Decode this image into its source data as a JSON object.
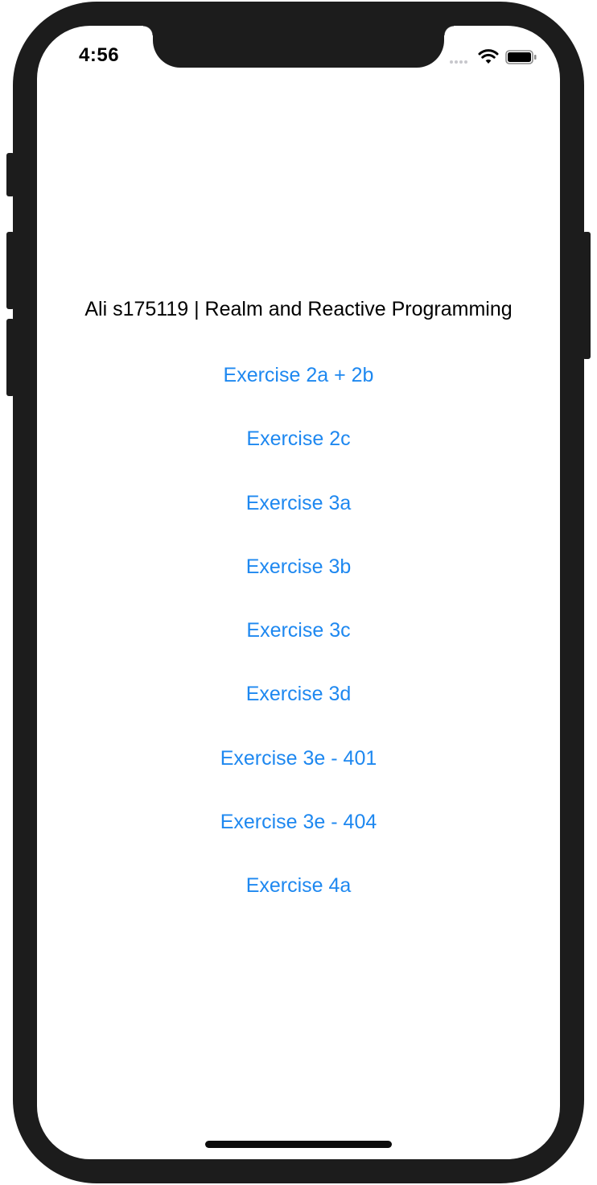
{
  "status_bar": {
    "time": "4:56",
    "signal_icon": "cellular-signal-icon",
    "wifi_icon": "wifi-icon",
    "battery_icon": "battery-icon"
  },
  "main": {
    "title": "Ali s175119 | Realm and Reactive Programming",
    "menu_items": [
      {
        "label": "Exercise 2a + 2b"
      },
      {
        "label": "Exercise 2c"
      },
      {
        "label": "Exercise 3a"
      },
      {
        "label": "Exercise 3b"
      },
      {
        "label": "Exercise 3c"
      },
      {
        "label": "Exercise 3d"
      },
      {
        "label": "Exercise 3e - 401"
      },
      {
        "label": "Exercise 3e - 404"
      },
      {
        "label": "Exercise 4a"
      }
    ]
  },
  "colors": {
    "accent": "#1e88f0",
    "frame": "#1c1c1c",
    "text": "#000000"
  }
}
